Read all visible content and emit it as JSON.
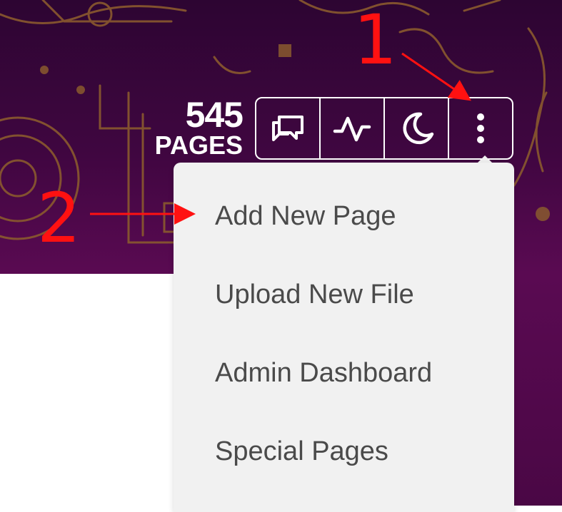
{
  "header": {
    "page_count": "545",
    "page_count_label": "PAGES"
  },
  "toolbar": {
    "buttons": [
      {
        "icon": "discussion-icon"
      },
      {
        "icon": "activity-icon"
      },
      {
        "icon": "moon-icon"
      },
      {
        "icon": "more-vertical-icon"
      }
    ]
  },
  "dropdown": {
    "items": [
      {
        "label": "Add New Page"
      },
      {
        "label": "Upload New File"
      },
      {
        "label": "Admin Dashboard"
      },
      {
        "label": "Special Pages"
      }
    ]
  },
  "annotations": {
    "step1": "1",
    "step2": "2",
    "color": "#ff1111"
  },
  "colors": {
    "header_bg": "#3f0640",
    "menu_bg": "#f1f1f1",
    "menu_text": "#4a4a4a"
  }
}
